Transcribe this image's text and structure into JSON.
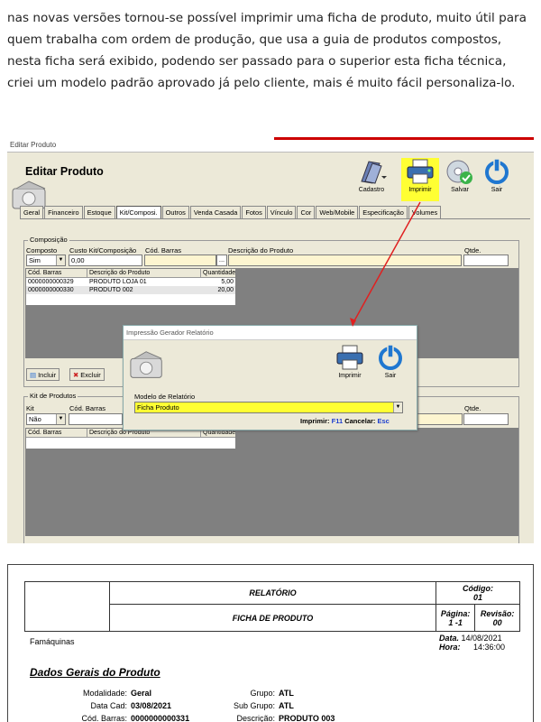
{
  "intro": {
    "text": "nas novas versões tornou-se possível imprimir uma ficha de produto, muito útil para quem trabalha com ordem de produção, que usa a guia de produtos compostos, nesta ficha será exibido, podendo ser passado para o superior esta ficha técnica, criei um modelo padrão aprovado já pelo cliente, mais é muito fácil personaliza-lo."
  },
  "editor": {
    "window_title": "Editar Produto",
    "header_title": "Editar Produto",
    "toolbar": {
      "cadastro": "Cadastro",
      "imprimir": "Imprimir",
      "salvar": "Salvar",
      "sair": "Sair"
    },
    "tabs": [
      "Geral",
      "Financeiro",
      "Estoque",
      "Kit/Composi.",
      "Outros",
      "Venda Casada",
      "Fotos",
      "Vínculo",
      "Cor",
      "Web/Mobile",
      "Especificação",
      "Volumes"
    ],
    "composicao": {
      "group_title": "Composição",
      "composto_label": "Composto",
      "composto_value": "Sim",
      "custo_label": "Custo Kit/Composição",
      "custo_value": "0,00",
      "cod_barras_label": "Cód. Barras",
      "descricao_label": "Descrição do Produto",
      "qtde_label": "Qtde.",
      "ellipsis": "...",
      "table_headers": [
        "Cód. Barras",
        "Descrição do Produto",
        "Quantidade"
      ],
      "rows": [
        {
          "cod": "0000000000329",
          "desc": "PRODUTO LOJA 01",
          "qtd": "5,00"
        },
        {
          "cod": "0000000000330",
          "desc": "PRODUTO 002",
          "qtd": "20,00"
        }
      ],
      "incluir": "Incluir",
      "excluir": "Excluir"
    },
    "kit": {
      "group_title": "Kit de Produtos",
      "kit_label": "Kit",
      "kit_value": "Não",
      "cod_barras_label": "Cód. Barras",
      "qtde_label": "Qtde.",
      "table_headers": [
        "Cód. Barras",
        "Descrição do Produto",
        "Quantidade"
      ]
    },
    "dialog": {
      "title": "Impressão Gerador Relatório",
      "imprimir": "Imprimir",
      "sair": "Sair",
      "modelo_label": "Modelo de Relatório",
      "modelo_value": "Ficha Produto",
      "shortcut_imprimir_label": "Imprimir:",
      "shortcut_imprimir_key": "F11",
      "shortcut_cancelar_label": "Cancelar:",
      "shortcut_cancelar_key": "Esc"
    }
  },
  "report": {
    "relatorio": "RELATÓRIO",
    "ficha": "FICHA DE PRODUTO",
    "codigo_label": "Código:",
    "codigo_value": "01",
    "pagina_label": "Página:",
    "pagina_value": "1 -1",
    "revisao_label": "Revisão:",
    "revisao_value": "00",
    "empresa": "Famáquinas",
    "data_label": "Data.",
    "data_value": "14/08/2021",
    "hora_label": "Hora:",
    "hora_value": "14:36:00",
    "section_title": "Dados Gerais do Produto",
    "modalidade_label": "Modalidade:",
    "modalidade_value": "Geral",
    "data_cad_label": "Data Cad:",
    "data_cad_value": "03/08/2021",
    "cod_barras_label": "Cód. Barras:",
    "cod_barras_value": "0000000000331",
    "grupo_label": "Grupo:",
    "grupo_value": "ATL",
    "subgrupo_label": "Sub Grupo:",
    "subgrupo_value": "ATL",
    "descricao_label": "Descrição:",
    "descricao_value": "PRODUTO 003"
  }
}
